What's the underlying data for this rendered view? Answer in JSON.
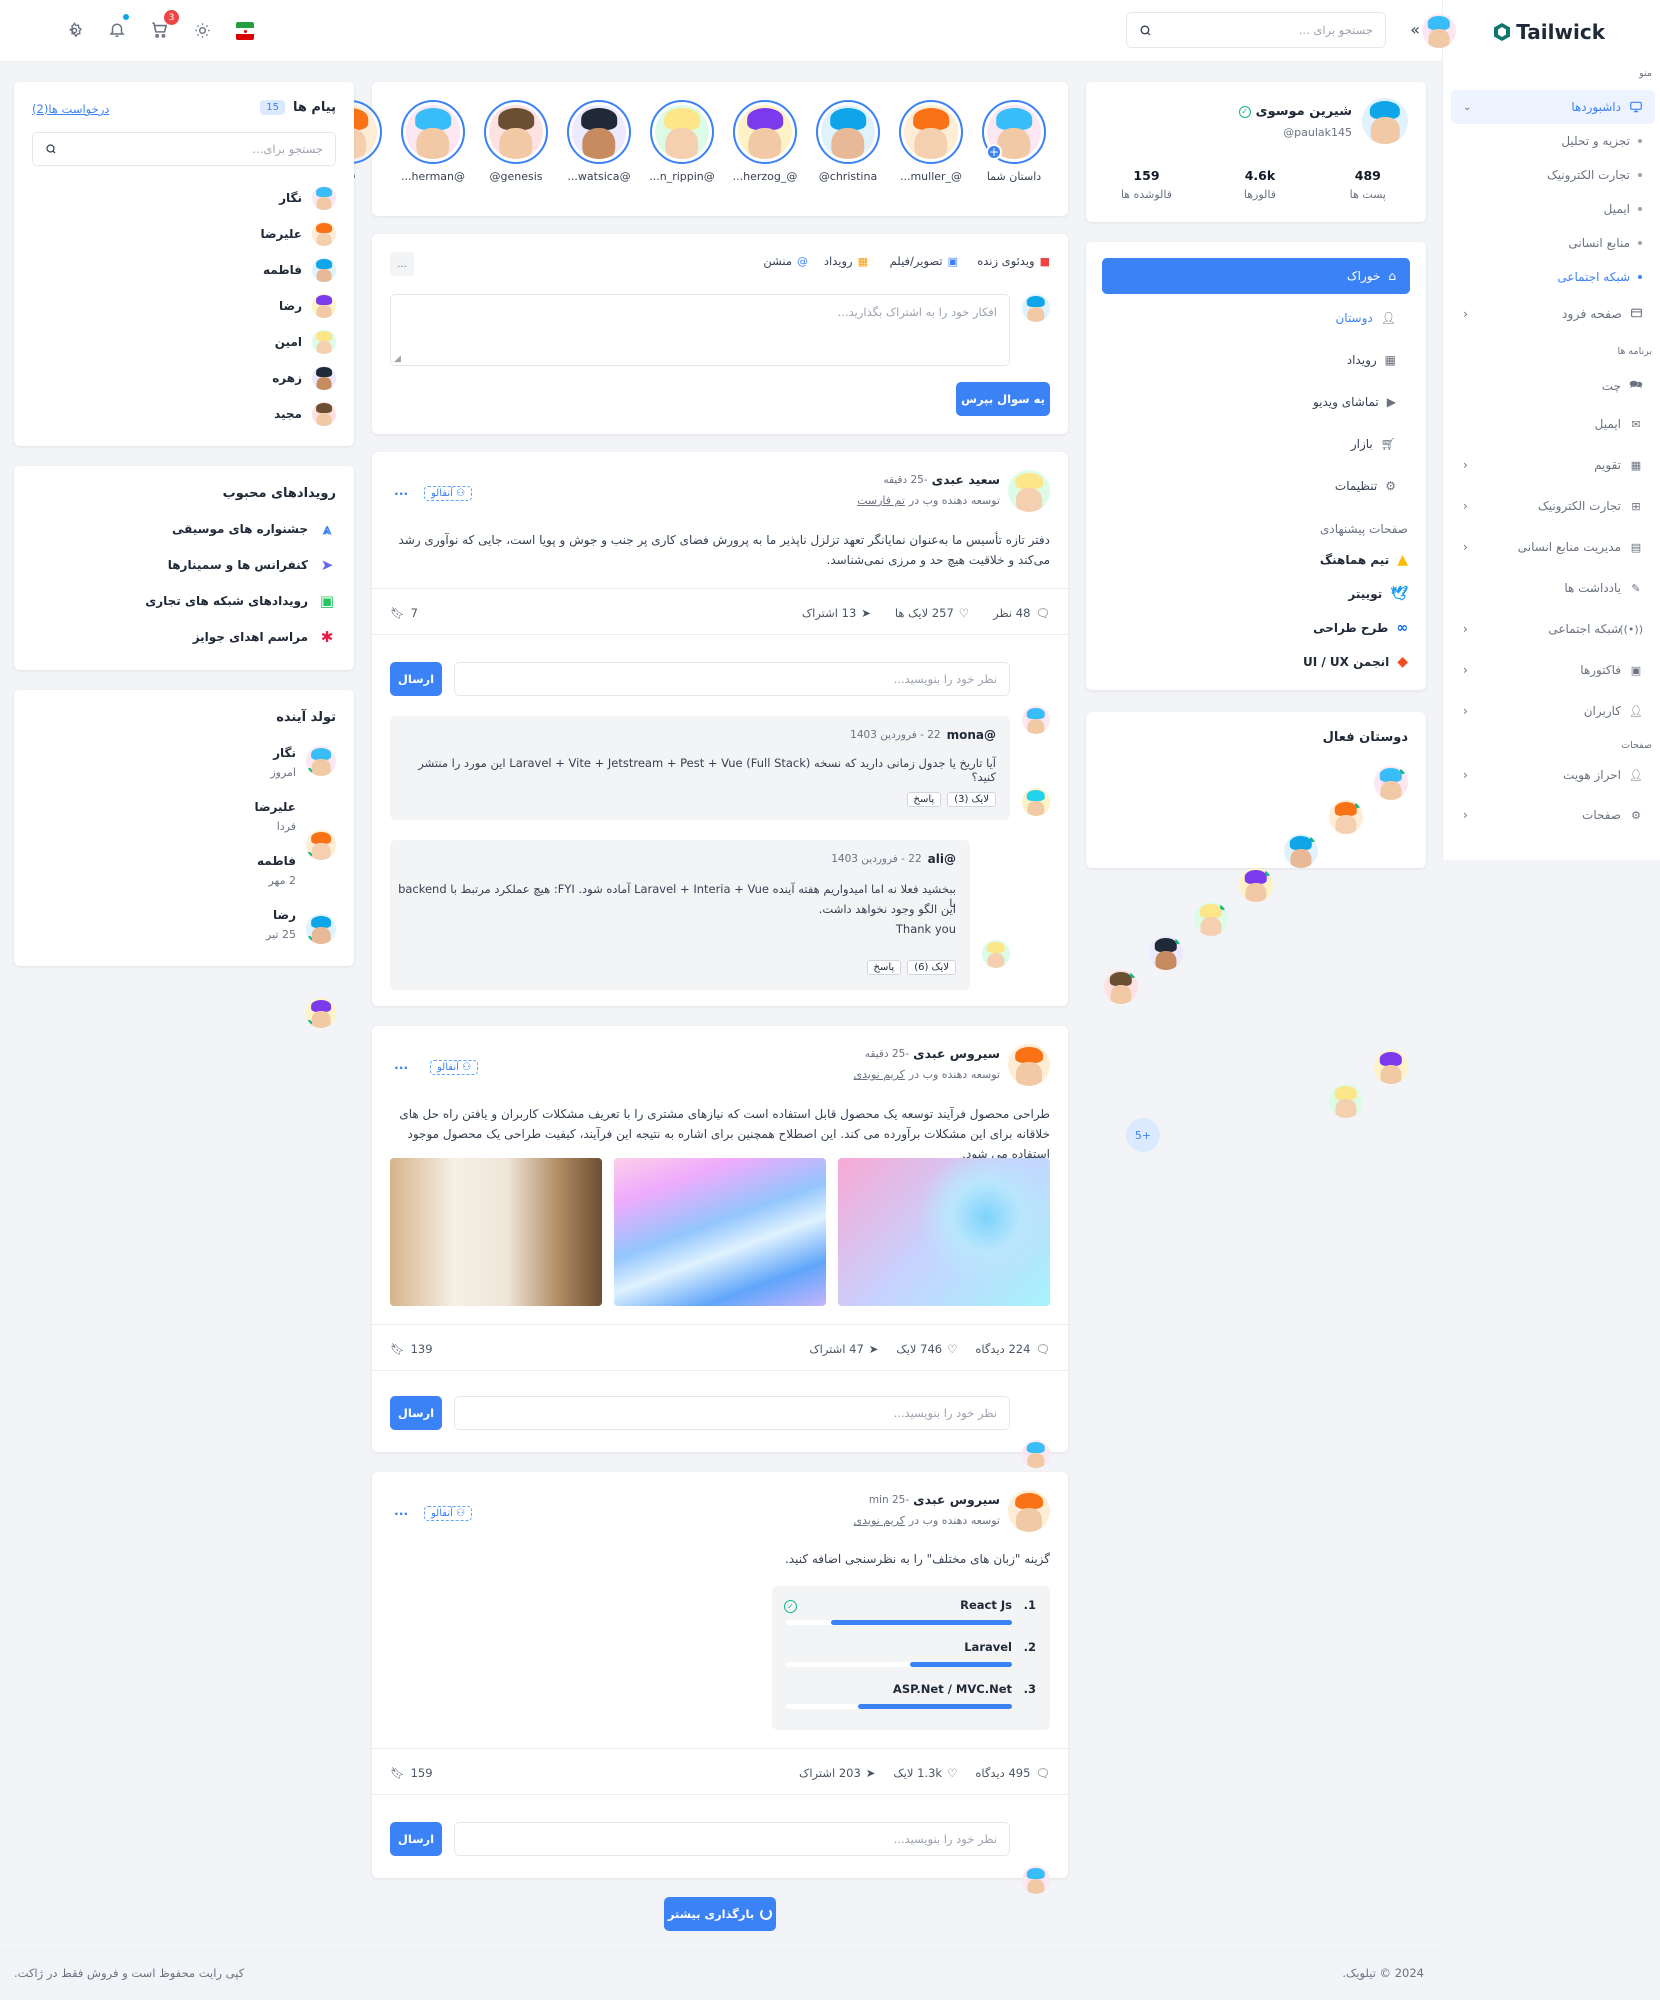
{
  "brand": {
    "name": "Tailwick"
  },
  "sidebar": {
    "section_menu": "منو",
    "dashboards": "داشبوردها",
    "sub_items": [
      "تجزیه و تحلیل",
      "تجارت الکترونیک",
      "ایمیل",
      "منابع انسانی",
      "شبکه اجتماعی"
    ],
    "landing": "صفحه فرود",
    "section_apps": "برنامه ها",
    "apps": [
      "چت",
      "ایمیل",
      "تقویم",
      "تجارت الکترونیک",
      "مدیریت منابع انسانی",
      "یادداشت ها",
      "شبکه اجتماعی",
      "فاکتورها",
      "کاربران"
    ],
    "section_pages": "صفحات",
    "pages": [
      "احراز هویت",
      "صفحات"
    ]
  },
  "header": {
    "search_placeholder": "جستجو برای ...",
    "cart_count": "3"
  },
  "profile": {
    "name": "شیرین موسوی",
    "handle": "paulak145@",
    "posts_num": "489",
    "posts_label": "پست ها",
    "followers_num": "4.6k",
    "followers_label": "فالورها",
    "following_num": "159",
    "following_label": "فالوشده ها"
  },
  "feed_nav": {
    "items": [
      "خوراک",
      "دوستان",
      "رویداد",
      "تماشای ویدیو",
      "بازار",
      "تنظیمات"
    ],
    "suggested_title": "صفحات پیشنهادی",
    "suggested": [
      "تیم هماهنگ",
      "توییتر",
      "طرح طراحی",
      "انجمن UI / UX"
    ]
  },
  "active_friends": {
    "title": "دوستان فعال",
    "more": "+5"
  },
  "stories": {
    "items": [
      "داستان شما",
      "@_muller...",
      "christina@",
      "@_herzog...",
      "@n_rippin...",
      "@watsica...",
      "genesis@",
      "@herman...",
      "@"
    ]
  },
  "composer": {
    "actions": [
      "ویدئوی زنده",
      "تصویر/فیلم",
      "رویداد",
      "منشن"
    ],
    "more": "...",
    "placeholder": "افکار خود را به اشتراک بگذارید...",
    "ask_button": "یه سوال بپرس"
  },
  "posts": [
    {
      "author": "سعید عبدی",
      "time": "-25 دقیقه",
      "role_prefix": "توسعه دهنده وب در",
      "role_link": "تم فارست",
      "tag": "آنفالو",
      "text": "دفتر تازه تأسیس ما به‌عنوان نمایانگر تعهد تزلزل ناپذیر ما به پرورش فضای کاری پر جنب و جوش و پویا است، جایی که نوآوری رشد می‌کند و خلاقیت هیچ حد و مرزی نمی‌شناسد.",
      "comments": "48 نظر",
      "likes": "257 لایک ها",
      "shares": "13 اشتراک",
      "saves": "7",
      "comment_placeholder": "نظر خود را بنویسید...",
      "send": "ارسال",
      "replies": [
        {
          "user": "@mona",
          "date": "22 - فروردین 1403",
          "text": "آیا تاریخ یا جدول زمانی دارید که نسخه Laravel + Vite + Jetstream + Pest + Vue (Full Stack) این مورد را منتشر کنید؟",
          "like": "لایک (3)",
          "reply": "پاسخ"
        },
        {
          "user": "@ali",
          "date": "22 - فروردین 1403",
          "text1": "ببخشید فعلا نه اما امیدواریم هفته آینده Laravel + Interia + Vue آماده شود. FYI: هیچ عملکرد مرتبط با backend با",
          "text2": "این الگو وجود نخواهد داشت.",
          "text3": "Thank you",
          "like": "لایک (6)",
          "reply": "پاسخ"
        }
      ]
    },
    {
      "author": "سیروس عبدی",
      "time": "-25 دقیقه",
      "role_prefix": "توسعه دهنده وب در",
      "role_link": "کریم نویدی",
      "tag": "آنفالو",
      "text": "طراحی محصول فرآیند توسعه یک محصول قابل استفاده است که نیازهای مشتری را با تعریف مشکلات کاربران و یافتن راه حل های خلاقانه برای این مشکلات برآورده می کند. این اصطلاح همچنین برای اشاره به نتیجه این فرآیند، کیفیت طراحی یک محصول موجود استفاده می شود.",
      "views": "224 دیدگاه",
      "likes": "746 لایک",
      "shares": "47 اشتراک",
      "saves": "139",
      "comment_placeholder": "نظر خود را بنویسید...",
      "send": "ارسال"
    },
    {
      "author": "سیروس عبدی",
      "time": "-25 min",
      "role_prefix": "توسعه دهنده وب در",
      "role_link": "کریم نویدی",
      "tag": "آنفالو",
      "text": "گزینه \"زبان های مختلف\" را به نظرسنجی اضافه کنید.",
      "poll": [
        {
          "num": "1.",
          "label": "React Js",
          "value": 0.8
        },
        {
          "num": "2.",
          "label": "Laravel",
          "value": 0.45
        },
        {
          "num": "3.",
          "label": "ASP.Net / MVC.Net",
          "value": 0.68
        }
      ],
      "views": "495 دیدگاه",
      "likes": "1.3k لایک",
      "shares": "203 اشتراک",
      "saves": "159",
      "comment_placeholder": "نظر خود را بنویسید...",
      "send": "ارسال"
    }
  ],
  "load_more": "بارگذاری بیشتر",
  "messages": {
    "title": "پیام ها",
    "count": "15",
    "requests": "درخواست ها(2)",
    "search_placeholder": "جستجو برای...",
    "contacts": [
      "نگار",
      "علیرضا",
      "فاطمه",
      "رضا",
      "امین",
      "زهره",
      "مجید"
    ]
  },
  "events": {
    "title": "رویدادهای محبوب",
    "items": [
      "جشنواره های موسیقی",
      "کنفرانس ها و سمینارها",
      "رویدادهای شبکه های تجاری",
      "مراسم اهدای جوایز"
    ]
  },
  "birthdays": {
    "title": "تولد آینده",
    "items": [
      {
        "name": "نگار",
        "when": "امروز"
      },
      {
        "name": "علیرضا",
        "when": "فردا"
      },
      {
        "name": "فاطمه",
        "when": "2 مهر"
      },
      {
        "name": "رضا",
        "when": "25 تیر"
      }
    ]
  },
  "footer": {
    "left": "کپی رایت محفوظ است و فروش فقط در ژاکت.",
    "right": "2024 © تیلویک."
  },
  "colors": {
    "accent": "#3b82f6",
    "bg": "#f3f4f7"
  }
}
